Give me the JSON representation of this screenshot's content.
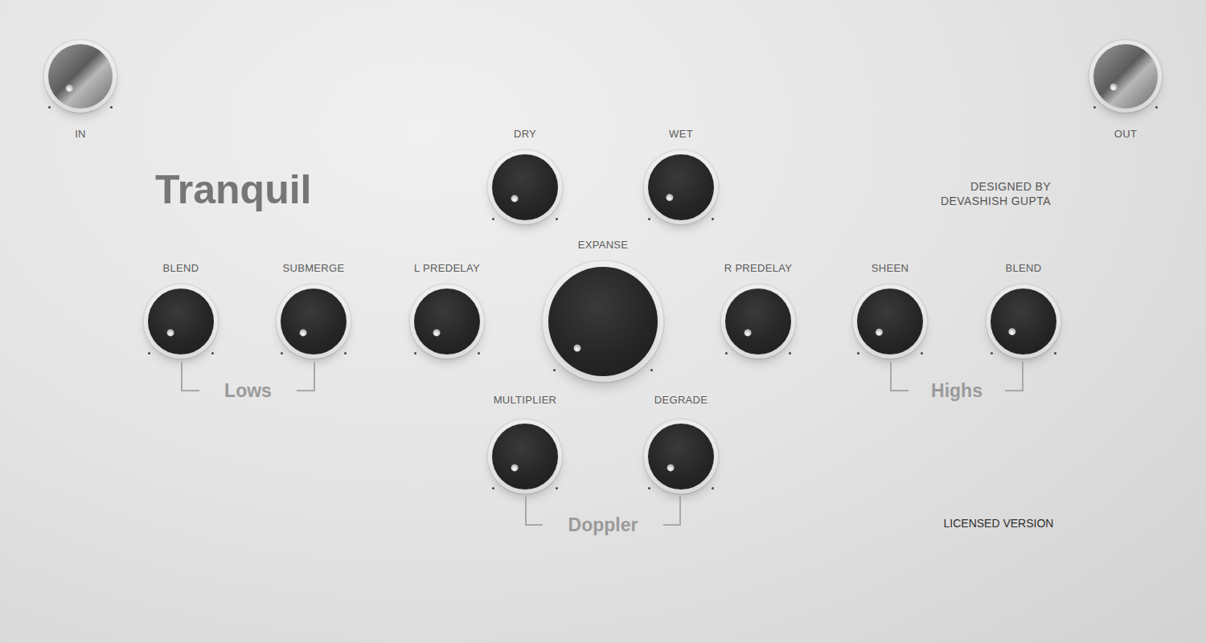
{
  "plugin": {
    "title": "Tranquil",
    "credit": [
      "DESIGNED BY",
      "DEVASHISH GUPTA"
    ],
    "license": "LICENSED VERSION"
  },
  "knobs": [
    {
      "label": "IN",
      "kind": "metal",
      "level": 0
    },
    {
      "label": "OUT",
      "kind": "metal",
      "level": 0.02
    },
    {
      "label": "DRY",
      "kind": "small",
      "level": 0
    },
    {
      "label": "WET",
      "kind": "small",
      "level": 0.02
    },
    {
      "label": "BLEND",
      "kind": "small",
      "level": 0
    },
    {
      "label": "SUBMERGE",
      "kind": "small",
      "level": 0
    },
    {
      "label": "L PREDELAY",
      "kind": "small",
      "level": 0
    },
    {
      "label": "EXPANSE",
      "kind": "large",
      "level": 0
    },
    {
      "label": "R PREDELAY",
      "kind": "small",
      "level": 0
    },
    {
      "label": "SHEEN",
      "kind": "small",
      "level": 0.01
    },
    {
      "label": "BLEND",
      "kind": "small",
      "level": 0.02
    },
    {
      "label": "MULTIPLIER",
      "kind": "small",
      "level": 0
    },
    {
      "label": "DEGRADE",
      "kind": "small",
      "level": 0
    }
  ],
  "groups": [
    {
      "label": "Lows"
    },
    {
      "label": "Highs"
    },
    {
      "label": "Doppler"
    }
  ]
}
